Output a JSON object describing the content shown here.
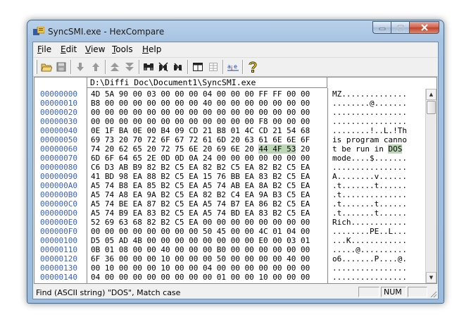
{
  "window": {
    "title": "SyncSMI.exe - HexCompare"
  },
  "menu": [
    {
      "label": "File",
      "accel": "F",
      "rest": "ile"
    },
    {
      "label": "Edit",
      "accel": "E",
      "rest": "dit"
    },
    {
      "label": "View",
      "accel": "V",
      "rest": "iew"
    },
    {
      "label": "Tools",
      "accel": "T",
      "rest": "ools"
    },
    {
      "label": "Help",
      "accel": "H",
      "rest": "elp"
    }
  ],
  "toolbar": {
    "buttons": [
      "open-folder-icon",
      "save-icon",
      "arrow-down-icon",
      "arrow-up-icon",
      "first-diff-icon",
      "last-diff-icon",
      "find-binoculars-icon",
      "find-next-icon",
      "find-prev-icon",
      "view-columns-icon",
      "view-grid-icon",
      "ascii-ebcdic-icon",
      "help-icon"
    ]
  },
  "hexview": {
    "path": "D:\\Diffi Doc\\Document1\\SyncSMI.exe",
    "rows": [
      {
        "addr": "00000000",
        "hex": "4D 5A 90 00 03 00 00 00 04 00 00 00 FF FF 00 00",
        "ascii": "MZ.............."
      },
      {
        "addr": "00000010",
        "hex": "B8 00 00 00 00 00 00 00 40 00 00 00 00 00 00 00",
        "ascii": "........@......."
      },
      {
        "addr": "00000020",
        "hex": "00 00 00 00 00 00 00 00 00 00 00 00 00 00 00 00",
        "ascii": "................"
      },
      {
        "addr": "00000030",
        "hex": "00 00 00 00 00 00 00 00 00 00 00 00 F8 00 00 00",
        "ascii": "................"
      },
      {
        "addr": "00000040",
        "hex": "0E 1F BA 0E 00 B4 09 CD 21 B8 01 4C CD 21 54 68",
        "ascii": "........!..L.!Th"
      },
      {
        "addr": "00000050",
        "hex": "69 73 20 70 72 6F 67 72 61 6D 20 63 61 6E 6E 6F",
        "ascii": "is program canno"
      },
      {
        "addr": "00000060",
        "hex_pre": "74 20 62 65 20 72 75 6E 20 69 6E 20 ",
        "hex_hl": "44 4F 53",
        "hex_post": " 20",
        "ascii_pre": "t be run in ",
        "ascii_hl": "DOS",
        "ascii_post": " "
      },
      {
        "addr": "00000070",
        "hex": "6D 6F 64 65 2E 0D 0D 0A 24 00 00 00 00 00 00 00",
        "ascii": "mode....$......."
      },
      {
        "addr": "00000080",
        "hex": "C6 D3 AB B9 82 B2 C5 EA 82 B2 C5 EA 82 B2 C5 EA",
        "ascii": "................"
      },
      {
        "addr": "00000090",
        "hex": "41 BD 98 EA 88 B2 C5 EA 15 76 BB EA 83 B2 C5 EA",
        "ascii": "A........v......"
      },
      {
        "addr": "000000A0",
        "hex": "A5 74 B8 EA 85 B2 C5 EA A5 74 AB EA 8A B2 C5 EA",
        "ascii": ".t.......t......"
      },
      {
        "addr": "000000B0",
        "hex": "A5 74 A8 EA 9A B2 C5 EA 82 B2 C4 EA 9A B3 C5 EA",
        "ascii": ".t.............."
      },
      {
        "addr": "000000C0",
        "hex": "A5 74 BE EA 87 B2 C5 EA A5 74 B7 EA 86 B2 C5 EA",
        "ascii": ".t.......t......"
      },
      {
        "addr": "000000D0",
        "hex": "A5 74 B9 EA 83 B2 C5 EA A5 74 BD EA 83 B2 C5 EA",
        "ascii": ".t.......t......"
      },
      {
        "addr": "000000E0",
        "hex": "52 69 63 68 82 B2 C5 EA 00 00 00 00 00 00 00 00",
        "ascii": "Rich............"
      },
      {
        "addr": "000000F0",
        "hex": "00 00 00 00 00 00 00 00 50 45 00 00 4C 01 04 00",
        "ascii": "........PE..L..."
      },
      {
        "addr": "00000100",
        "hex": "D5 05 AD 4B 00 00 00 00 00 00 00 00 E0 00 03 01",
        "ascii": "...K............"
      },
      {
        "addr": "00000110",
        "hex": "0B 01 08 00 00 40 00 00 00 B0 00 00 00 00 00 00",
        "ascii": ".....@.........."
      },
      {
        "addr": "00000120",
        "hex": "6F 36 00 00 00 10 00 00 00 50 00 00 00 00 40 00",
        "ascii": "o6.......P....@."
      },
      {
        "addr": "00000130",
        "hex": "00 10 00 00 00 10 00 00 04 00 00 00 00 00 00 00",
        "ascii": "................"
      },
      {
        "addr": "00000140",
        "hex": "04 00 00 00 00 00 00 00 00 01 00 00 10 00 00 00",
        "ascii": "................"
      }
    ]
  },
  "status": {
    "message": "Find (ASCII string) \"DOS\", Match case",
    "num": "NUM"
  },
  "colors": {
    "address": "#3a5fbf",
    "highlight": "#bcd7b6"
  }
}
